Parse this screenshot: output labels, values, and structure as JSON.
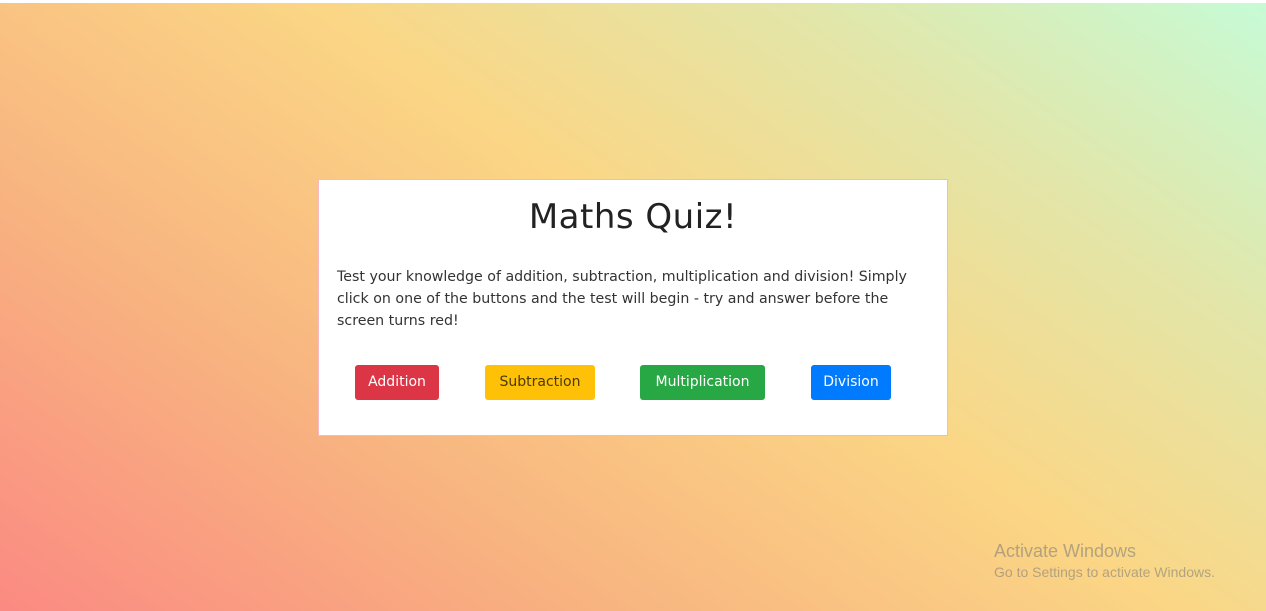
{
  "colors": {
    "addition": "#dc3545",
    "subtraction": "#ffc107",
    "multiplication": "#28a745",
    "division": "#007bff",
    "card_border": "#f6b9c4"
  },
  "quiz": {
    "title": "Maths Quiz!",
    "intro": "Test your knowledge of addition, subtraction, multiplication and division! Simply click on one of the buttons and the test will begin - try and answer before the screen turns red!",
    "buttons": {
      "addition": "Addition",
      "subtraction": "Subtraction",
      "multiplication": "Multiplication",
      "division": "Division"
    }
  },
  "watermark": {
    "title": "Activate Windows",
    "subtitle": "Go to Settings to activate Windows."
  }
}
